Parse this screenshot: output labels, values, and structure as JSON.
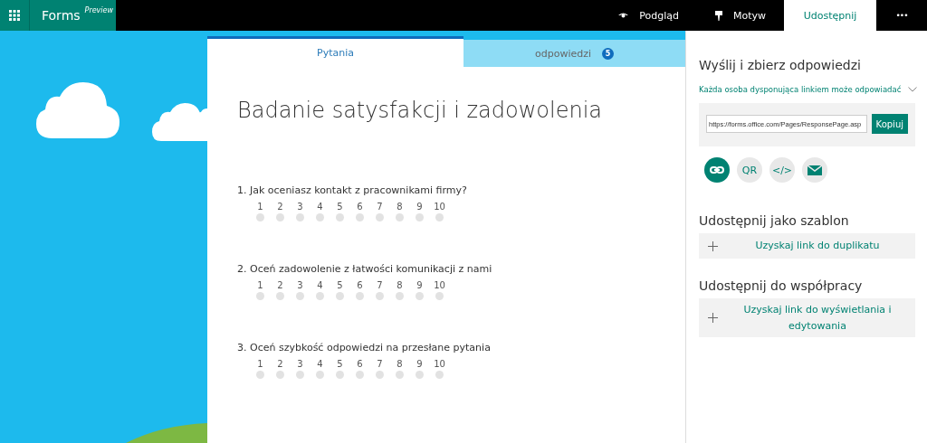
{
  "app": {
    "name": "Forms",
    "badge": "Preview"
  },
  "nav": [
    {
      "label": "Podgląd",
      "selected": false
    },
    {
      "label": "Motyw",
      "selected": false
    },
    {
      "label": "Udostępnij",
      "selected": true
    }
  ],
  "more": "•••",
  "tabs": [
    {
      "label": "Pytania",
      "selected": true
    },
    {
      "label": "odpowiedzi",
      "count": "5",
      "selected": false
    }
  ],
  "form": {
    "title": "Badanie satysfakcji i zadowolenia",
    "questions": [
      {
        "text": "1. Jak oceniasz kontakt z pracownikami firmy?",
        "scale": [
          {
            "label": "1",
            "checked": false
          },
          {
            "label": "2",
            "checked": false
          },
          {
            "label": "3",
            "checked": false
          },
          {
            "label": "4",
            "checked": false
          },
          {
            "label": "5",
            "checked": false
          },
          {
            "label": "6",
            "checked": false
          },
          {
            "label": "7",
            "checked": false
          },
          {
            "label": "8",
            "checked": false
          },
          {
            "label": "9",
            "checked": false
          },
          {
            "label": "10",
            "checked": false
          }
        ]
      },
      {
        "text": "2. Oceń zadowolenie z łatwości komunikacji z nami",
        "scale": [
          {
            "label": "1",
            "checked": false
          },
          {
            "label": "2",
            "checked": false
          },
          {
            "label": "3",
            "checked": false
          },
          {
            "label": "4",
            "checked": false
          },
          {
            "label": "5",
            "checked": false
          },
          {
            "label": "6",
            "checked": false
          },
          {
            "label": "7",
            "checked": false
          },
          {
            "label": "8",
            "checked": false
          },
          {
            "label": "9",
            "checked": false
          },
          {
            "label": "10",
            "checked": false
          }
        ]
      },
      {
        "text": "3. Oceń szybkość odpowiedzi na przesłane pytania",
        "scale": [
          {
            "label": "1",
            "checked": false
          },
          {
            "label": "2",
            "checked": false
          },
          {
            "label": "3",
            "checked": false
          },
          {
            "label": "4",
            "checked": false
          },
          {
            "label": "5",
            "checked": false
          },
          {
            "label": "6",
            "checked": false
          },
          {
            "label": "7",
            "checked": false
          },
          {
            "label": "8",
            "checked": false
          },
          {
            "label": "9",
            "checked": false
          },
          {
            "label": "10",
            "checked": false
          }
        ]
      }
    ]
  },
  "share": {
    "title": "Wyślij i zbierz odpowiedzi",
    "audience": "Każda osoba dysponująca linkiem może odpowiadać",
    "link": "https://forms.office.com/Pages/ResponsePage.asp",
    "copy": "Kopiuj",
    "options": [
      {
        "kind": "link",
        "selected": true
      },
      {
        "kind": "text",
        "label": "QR",
        "selected": false
      },
      {
        "kind": "text",
        "label": "</>",
        "selected": false
      },
      {
        "kind": "mail",
        "selected": false
      }
    ],
    "sections": [
      {
        "title": "Udostępnij jako szablon",
        "action": "Uzyskaj link do duplikatu"
      },
      {
        "title": "Udostępnij do współpracy",
        "action": "Uzyskaj link do wyświetlania i edytowania"
      }
    ]
  }
}
